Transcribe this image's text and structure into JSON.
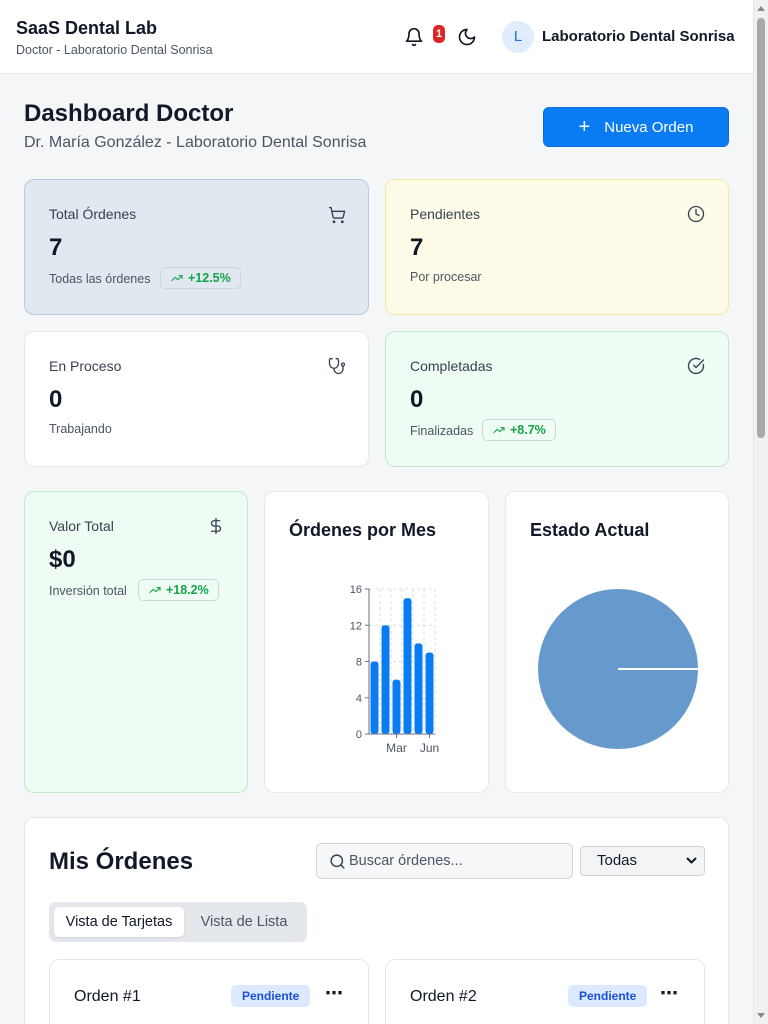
{
  "header": {
    "title": "SaaS Dental Lab",
    "subtitle": "Doctor - Laboratorio Dental Sonrisa",
    "notifications_count": "1",
    "avatar_initial": "L",
    "account_name": "Laboratorio Dental Sonrisa"
  },
  "page": {
    "title": "Dashboard Doctor",
    "subtitle": "Dr. María González - Laboratorio Dental Sonrisa",
    "new_order_label": "Nueva Orden"
  },
  "stats": {
    "total": {
      "label": "Total Órdenes",
      "value": "7",
      "desc": "Todas las órdenes",
      "trend": "+12.5%",
      "icon": "cart-icon"
    },
    "pending": {
      "label": "Pendientes",
      "value": "7",
      "desc": "Por procesar",
      "icon": "clock-icon"
    },
    "in_process": {
      "label": "En Proceso",
      "value": "0",
      "desc": "Trabajando",
      "icon": "stethoscope-icon"
    },
    "completed": {
      "label": "Completadas",
      "value": "0",
      "desc": "Finalizadas",
      "trend": "+8.7%",
      "icon": "check-circle-icon"
    },
    "total_value": {
      "label": "Valor Total",
      "value": "$0",
      "desc": "Inversión total",
      "trend": "+18.2%",
      "icon": "dollar-icon"
    }
  },
  "charts": {
    "monthly_title": "Órdenes por Mes",
    "status_title": "Estado Actual"
  },
  "chart_data": [
    {
      "type": "bar",
      "title": "Órdenes por Mes",
      "categories": [
        "",
        "",
        "Mar",
        "",
        "",
        "Jun"
      ],
      "values": [
        8,
        12,
        6,
        15,
        10,
        9
      ],
      "yticks": [
        0,
        4,
        8,
        12,
        16
      ],
      "ylim": [
        0,
        16
      ],
      "grid": true,
      "color": "#0a7cf3"
    },
    {
      "type": "pie",
      "title": "Estado Actual",
      "values": [
        100
      ],
      "color": "#6699cc"
    }
  ],
  "orders": {
    "title": "Mis Órdenes",
    "search_placeholder": "Buscar órdenes...",
    "filter_selected": "Todas",
    "tabs": [
      "Vista de Tarjetas",
      "Vista de Lista"
    ],
    "items": [
      {
        "title": "Orden #1",
        "status": "Pendiente"
      },
      {
        "title": "Orden #2",
        "status": "Pendiente"
      }
    ]
  },
  "colors": {
    "accent": "#0a7cf3",
    "trend_positive": "#16a34a",
    "notification": "#dc2626",
    "pending_badge_bg": "#dbeafe",
    "pending_badge_text": "#1d4ed8"
  }
}
